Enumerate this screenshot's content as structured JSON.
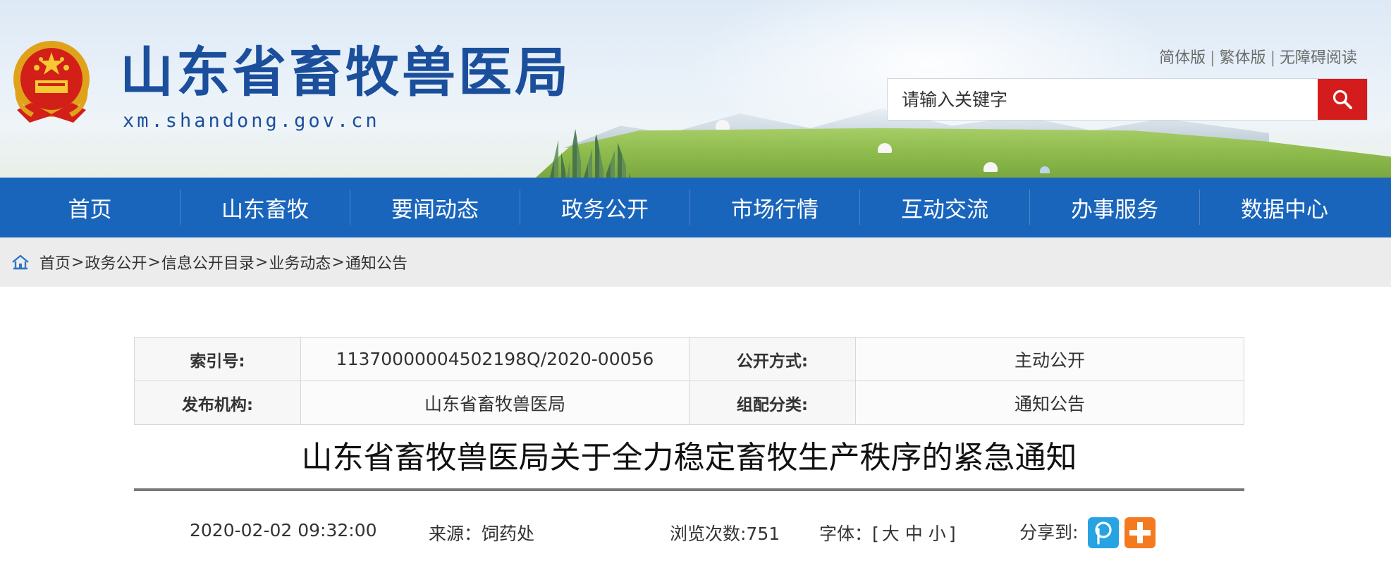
{
  "header": {
    "title": "山东省畜牧兽医局",
    "domain": "xm.shandong.gov.cn",
    "lang_links": [
      "简体版",
      "繁体版",
      "无障碍阅读"
    ],
    "search": {
      "placeholder": "请输入关键字",
      "value": ""
    },
    "emblem_icon": "national-emblem-icon",
    "search_icon": "search-icon",
    "search_button_color": "#d41c1c"
  },
  "nav": {
    "items": [
      "首页",
      "山东畜牧",
      "要闻动态",
      "政务公开",
      "市场行情",
      "互动交流",
      "办事服务",
      "数据中心"
    ],
    "background": "#1a65bc"
  },
  "breadcrumb": {
    "icon": "home-icon",
    "items": [
      "首页",
      "政务公开",
      "信息公开目录",
      "业务动态",
      "通知公告"
    ],
    "separator": ">"
  },
  "info_table": {
    "index_label": "索引号:",
    "index_value": "11370000004502198Q/2020-00056",
    "disclosure_label": "公开方式:",
    "disclosure_value": "主动公开",
    "issuer_label": "发布机构:",
    "issuer_value": "山东省畜牧兽医局",
    "category_label": "组配分类:",
    "category_value": "通知公告"
  },
  "article": {
    "title": "山东省畜牧兽医局关于全力稳定畜牧生产秩序的紧急通知",
    "date": "2020-02-02 09:32:00",
    "source": "来源：饲药处",
    "views": "浏览次数:751",
    "font_label": "字体：[",
    "font_sizes": [
      "大",
      "中",
      "小"
    ],
    "font_close": "]",
    "share_label": "分享到:",
    "share_icons": [
      "share-p-icon",
      "share-plus-icon"
    ]
  }
}
